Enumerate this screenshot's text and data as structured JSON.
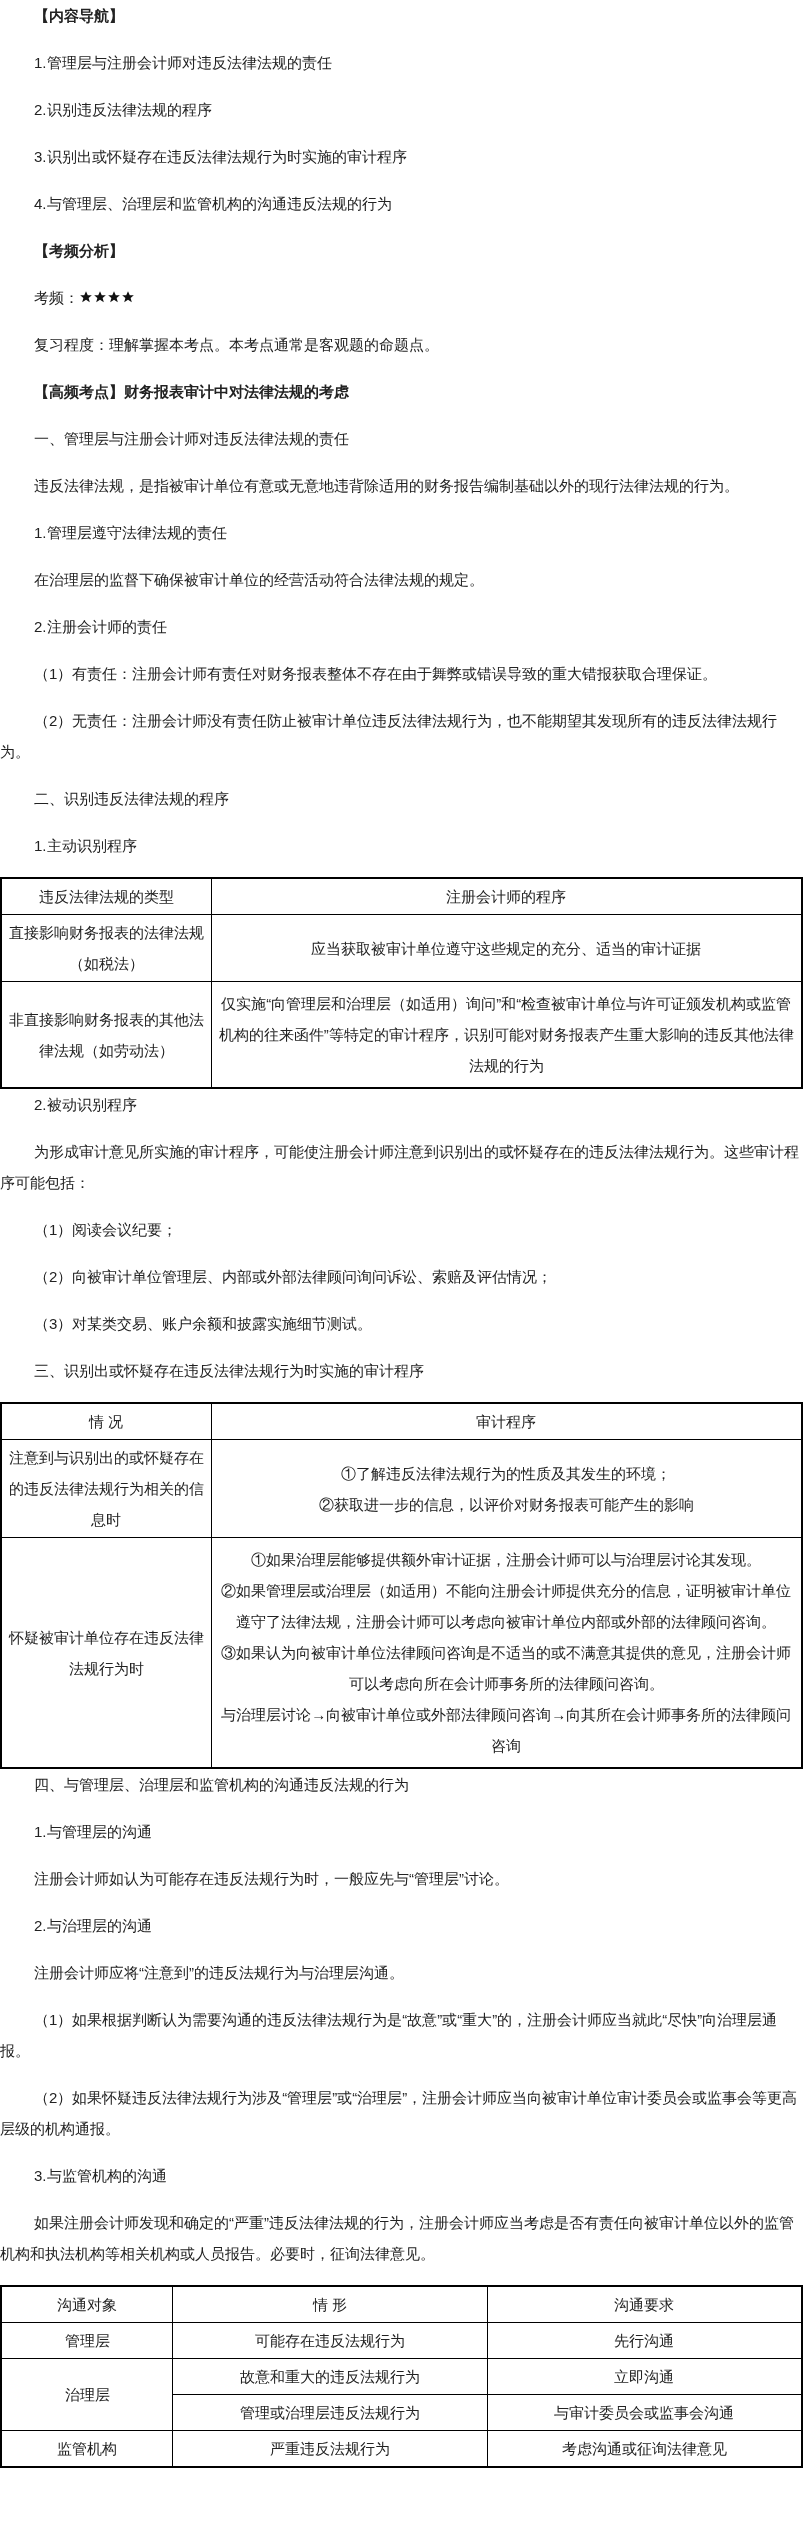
{
  "blocks": [
    {
      "kind": "heading",
      "text": "【内容导航】"
    },
    {
      "kind": "item",
      "text": "1.管理层与注册会计师对违反法律法规的责任"
    },
    {
      "kind": "item",
      "text": "2.识别违反法律法规的程序"
    },
    {
      "kind": "item",
      "text": "3.识别出或怀疑存在违反法律法规行为时实施的审计程序"
    },
    {
      "kind": "item",
      "text": "4.与管理层、治理层和监管机构的沟通违反法规的行为"
    },
    {
      "kind": "heading",
      "text": "【考频分析】"
    },
    {
      "kind": "rating",
      "label": "考频：",
      "stars": 4
    },
    {
      "kind": "item",
      "text": "复习程度：理解掌握本考点。本考点通常是客观题的命题点。"
    },
    {
      "kind": "heading",
      "text": "【高频考点】财务报表审计中对法律法规的考虑"
    },
    {
      "kind": "paragraph",
      "text": "一、管理层与注册会计师对违反法律法规的责任"
    },
    {
      "kind": "paragraph",
      "text": "违反法律法规，是指被审计单位有意或无意地违背除适用的财务报告编制基础以外的现行法律法规的行为。"
    },
    {
      "kind": "paragraph",
      "text": "1.管理层遵守法律法规的责任"
    },
    {
      "kind": "paragraph",
      "text": "在治理层的监督下确保被审计单位的经营活动符合法律法规的规定。"
    },
    {
      "kind": "paragraph",
      "text": "2.注册会计师的责任"
    },
    {
      "kind": "paragraph",
      "text": "（1）有责任：注册会计师有责任对财务报表整体不存在由于舞弊或错误导致的重大错报获取合理保证。"
    },
    {
      "kind": "paragraph",
      "text": "（2）无责任：注册会计师没有责任防止被审计单位违反法律法规行为，也不能期望其发现所有的违反法律法规行为。"
    },
    {
      "kind": "paragraph",
      "text": "二、识别违反法律法规的程序"
    },
    {
      "kind": "paragraph",
      "text": "1.主动识别程序"
    },
    {
      "kind": "table",
      "columns": [
        "违反法律法规的类型",
        "注册会计师的程序"
      ],
      "rows": [
        [
          "直接影响财务报表的法律法规（如税法）",
          [
            "应当获取被审计单位遵守这些规定的充分、适当的审计证据"
          ]
        ],
        [
          "非直接影响财务报表的其他法律法规（如劳动法）",
          [
            "仅实施“向管理层和治理层（如适用）询问”和“检查被审计单位与许可证颁发机构或监管机构的往来函件”等特定的审计程序，识别可能对财务报表产生重大影响的违反其他法律法规的行为"
          ]
        ]
      ]
    },
    {
      "kind": "paragraph",
      "text": "2.被动识别程序"
    },
    {
      "kind": "paragraph",
      "text": "为形成审计意见所实施的审计程序，可能使注册会计师注意到识别出的或怀疑存在的违反法律法规行为。这些审计程序可能包括："
    },
    {
      "kind": "paragraph",
      "text": "（1）阅读会议纪要；"
    },
    {
      "kind": "paragraph",
      "text": "（2）向被审计单位管理层、内部或外部法律顾问询问诉讼、索赔及评估情况；"
    },
    {
      "kind": "paragraph",
      "text": "（3）对某类交易、账户余额和披露实施细节测试。"
    },
    {
      "kind": "paragraph",
      "text": "三、识别出或怀疑存在违反法律法规行为时实施的审计程序"
    },
    {
      "kind": "table",
      "columns": [
        "情 况",
        "审计程序"
      ],
      "rows": [
        [
          "注意到与识别出的或怀疑存在的违反法律法规行为相关的信息时",
          [
            "①了解违反法律法规行为的性质及其发生的环境；",
            "②获取进一步的信息，以评价对财务报表可能产生的影响"
          ]
        ],
        [
          "怀疑被审计单位存在违反法律法规行为时",
          [
            "①如果治理层能够提供额外审计证据，注册会计师可以与治理层讨论其发现。",
            "②如果管理层或治理层（如适用）不能向注册会计师提供充分的信息，证明被审计单位遵守了法律法规，注册会计师可以考虑向被审计单位内部或外部的法律顾问咨询。",
            "③如果认为向被审计单位法律顾问咨询是不适当的或不满意其提供的意见，注册会计师可以考虑向所在会计师事务所的法律顾问咨询。",
            "与治理层讨论→向被审计单位或外部法律顾问咨询→向其所在会计师事务所的法律顾问咨询"
          ]
        ]
      ]
    },
    {
      "kind": "paragraph",
      "text": "四、与管理层、治理层和监管机构的沟通违反法规的行为"
    },
    {
      "kind": "paragraph",
      "text": "1.与管理层的沟通"
    },
    {
      "kind": "paragraph",
      "text": "注册会计师如认为可能存在违反法规行为时，一般应先与“管理层”讨论。"
    },
    {
      "kind": "paragraph",
      "text": "2.与治理层的沟通"
    },
    {
      "kind": "paragraph",
      "text": "注册会计师应将“注意到”的违反法规行为与治理层沟通。"
    },
    {
      "kind": "paragraph",
      "text": "（1）如果根据判断认为需要沟通的违反法律法规行为是“故意”或“重大”的，注册会计师应当就此“尽快”向治理层通报。"
    },
    {
      "kind": "paragraph",
      "text": "（2）如果怀疑违反法律法规行为涉及“管理层”或“治理层”，注册会计师应当向被审计单位审计委员会或监事会等更高层级的机构通报。"
    },
    {
      "kind": "paragraph",
      "text": "3.与监管机构的沟通"
    },
    {
      "kind": "paragraph",
      "text": "如果注册会计师发现和确定的“严重”违反法律法规的行为，注册会计师应当考虑是否有责任向被审计单位以外的监管机构和执法机构等相关机构或人员报告。必要时，征询法律意见。"
    },
    {
      "kind": "grouped_table",
      "columns": [
        "沟通对象",
        "情 形",
        "沟通要求"
      ],
      "groups": [
        {
          "object": "管理层",
          "items": [
            [
              "可能存在违反法规行为",
              "先行沟通"
            ]
          ]
        },
        {
          "object": "治理层",
          "items": [
            [
              "故意和重大的违反法规行为",
              "立即沟通"
            ],
            [
              "管理或治理层违反法规行为",
              "与审计委员会或监事会沟通"
            ]
          ]
        },
        {
          "object": "监管机构",
          "items": [
            [
              "严重违反法规行为",
              "考虑沟通或征询法律意见"
            ]
          ]
        }
      ]
    }
  ]
}
